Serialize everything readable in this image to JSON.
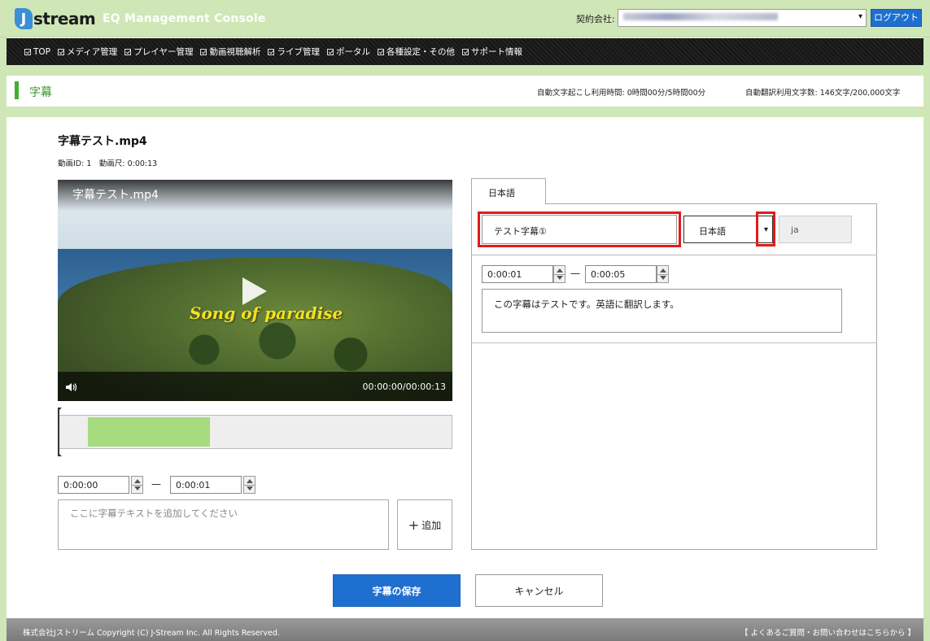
{
  "header": {
    "logo_text": "stream",
    "logo_letter": "J",
    "console_title": "EQ Management Console",
    "contract_label": "契約会社:",
    "logout_label": "ログアウト"
  },
  "nav": {
    "items": [
      {
        "label": "TOP"
      },
      {
        "label": "メディア管理"
      },
      {
        "label": "プレイヤー管理"
      },
      {
        "label": "動画視聴解析"
      },
      {
        "label": "ライブ管理"
      },
      {
        "label": "ポータル"
      },
      {
        "label": "各種設定・その他"
      },
      {
        "label": "サポート情報"
      }
    ]
  },
  "page": {
    "title": "字幕",
    "usage_transcribe": "自動文字起こし利用時間: 0時間00分/5時間00分",
    "usage_translate": "自動翻訳利用文字数: 146文字/200,000文字"
  },
  "video": {
    "title": "字幕テスト.mp4",
    "meta": "動画ID: 1　動画尺: 0:00:13",
    "player_name": "字幕テスト.mp4",
    "overlay_text": "Song of paradise",
    "time_display": "00:00:00/00:00:13"
  },
  "editor": {
    "start_time": "0:00:00",
    "end_time": "0:00:01",
    "dash": "—",
    "text_placeholder": "ここに字幕テキストを追加してください",
    "add_label": "追加",
    "add_plus": "+"
  },
  "track": {
    "tab_label": "日本語",
    "name": "テスト字幕①",
    "language": "日本語",
    "language_code": "ja",
    "entries": [
      {
        "start": "0:00:01",
        "end": "0:00:05",
        "text": "この字幕はテストです。英語に翻訳します。"
      }
    ]
  },
  "actions": {
    "save_label": "字幕の保存",
    "cancel_label": "キャンセル"
  },
  "footer": {
    "copyright": "株式会社Jストリーム  Copyright (C) J-Stream Inc. All Rights Reserved.",
    "support_link": "【 よくあるご質問・お問い合わせはこちらから 】"
  },
  "colors": {
    "header_bg": "#cfe7b6",
    "accent_blue": "#1f6fd0",
    "highlight_red": "#e01b1b",
    "range_green": "#a6dc7f",
    "title_green": "#3a9a2c"
  }
}
